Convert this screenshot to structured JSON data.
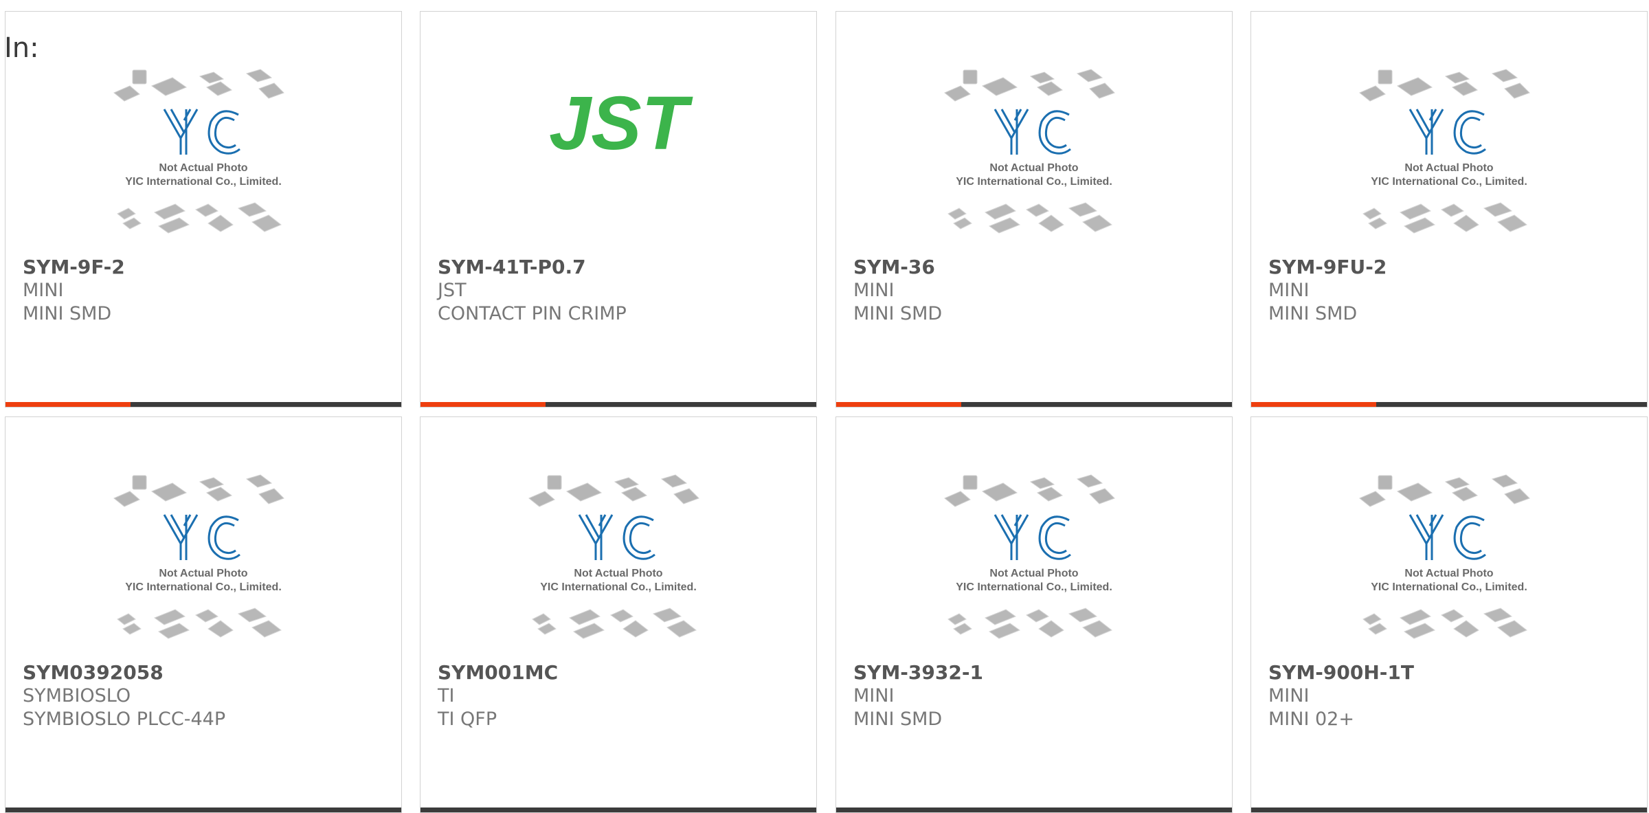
{
  "header": {
    "in_label": "In:"
  },
  "placeholder_text": {
    "line1": "Not Actual Photo",
    "line2": "YIC International Co., Limited."
  },
  "brand_logo_text": "YIC",
  "jst_logo_text": "JST",
  "colors": {
    "accent": "#ee3f0f",
    "bar": "#3b3b3b",
    "jst_green": "#3cb44b",
    "yic_blue": "#1b6fb0"
  },
  "cards": [
    {
      "part": "SYM-9F-2",
      "brand": "MINI",
      "desc": "MINI SMD",
      "image": "yic-placeholder"
    },
    {
      "part": "SYM-41T-P0.7",
      "brand": "JST",
      "desc": "CONTACT PIN CRIMP",
      "image": "jst-logo"
    },
    {
      "part": "SYM-36",
      "brand": "MINI",
      "desc": "MINI SMD",
      "image": "yic-placeholder"
    },
    {
      "part": "SYM-9FU-2",
      "brand": "MINI",
      "desc": "MINI SMD",
      "image": "yic-placeholder"
    },
    {
      "part": "SYM0392058",
      "brand": "SYMBIOSLO",
      "desc": "SYMBIOSLO PLCC-44P",
      "image": "yic-placeholder"
    },
    {
      "part": "SYM001MC",
      "brand": "TI",
      "desc": "TI QFP",
      "image": "yic-placeholder"
    },
    {
      "part": "SYM-3932-1",
      "brand": "MINI",
      "desc": "MINI SMD",
      "image": "yic-placeholder"
    },
    {
      "part": "SYM-900H-1T",
      "brand": "MINI",
      "desc": "MINI 02+",
      "image": "yic-placeholder"
    }
  ]
}
